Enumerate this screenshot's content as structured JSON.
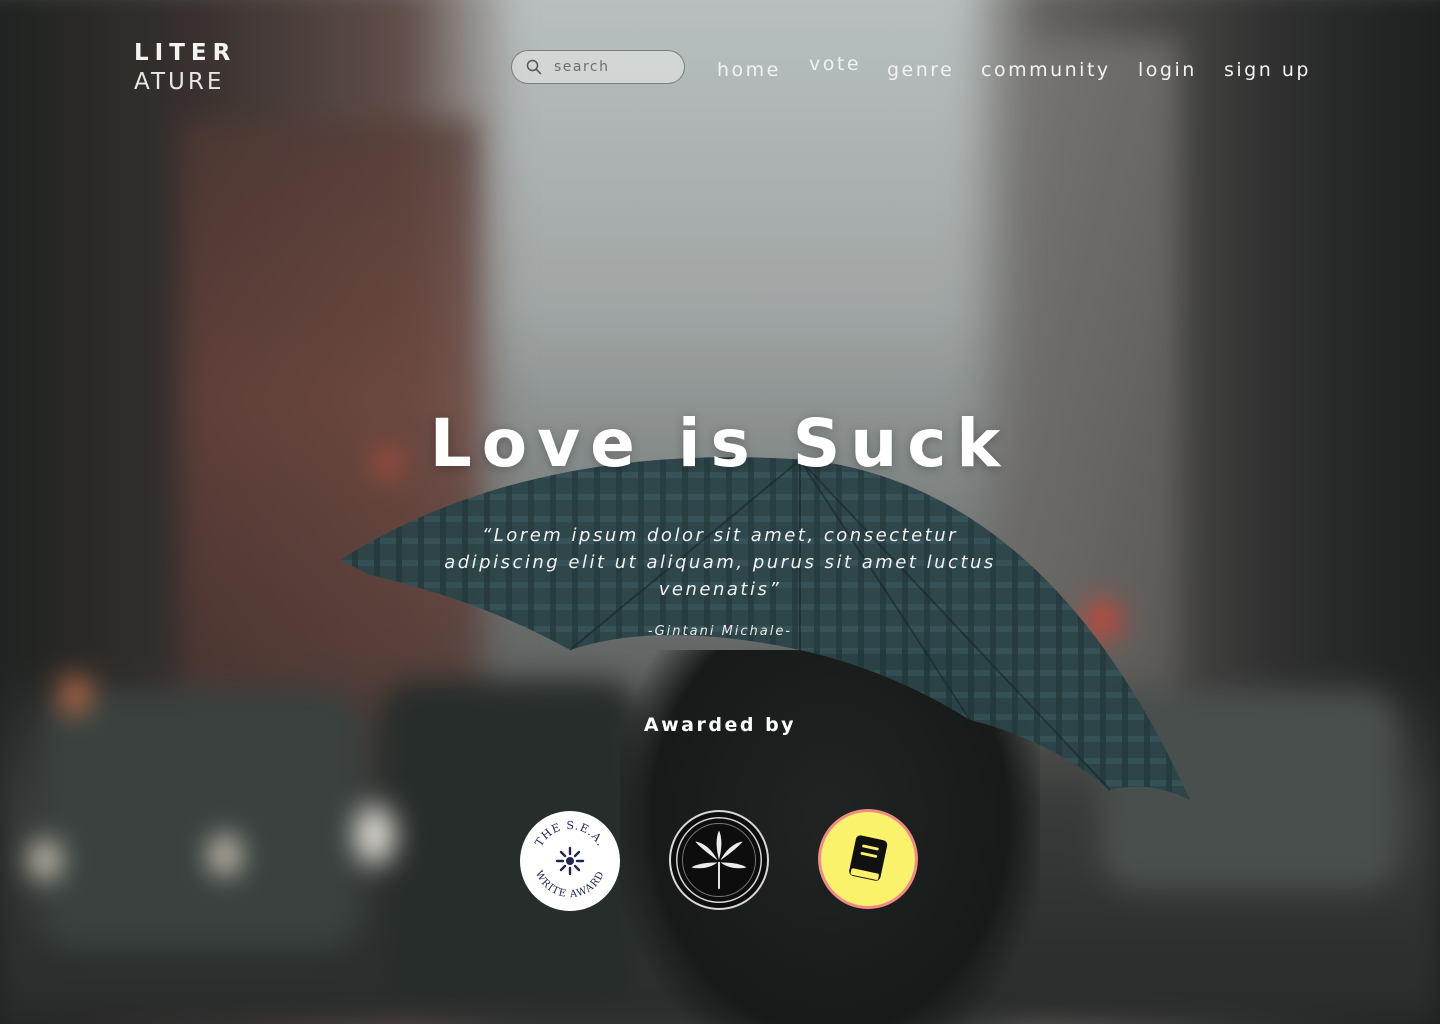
{
  "logo": {
    "line1": "LITER",
    "line2": "ATURE"
  },
  "search": {
    "placeholder": "search",
    "value": "",
    "icon": "search-icon"
  },
  "nav": {
    "home": "home",
    "vote": "vote",
    "genre": "genre",
    "community": "community",
    "login": "login",
    "signup": "sign up"
  },
  "hero": {
    "title": "Love is Suck",
    "quote": "“Lorem ipsum dolor sit amet, consectetur adipiscing elit ut aliquam, purus sit amet luctus venenatis”",
    "author": "-Gintani Michale-"
  },
  "awards": {
    "heading": "Awarded by",
    "items": [
      {
        "name": "sea-write-award",
        "text_top": "THE S.E.A.",
        "text_bottom": "WRITE AWARD",
        "icon": "sun-icon"
      },
      {
        "name": "palm-award",
        "icon": "palm-leaf-icon"
      },
      {
        "name": "book-award",
        "icon": "book-icon"
      }
    ]
  },
  "colors": {
    "text": "#ffffff",
    "book_badge_fill": "#fbf26c",
    "book_badge_ring": "#f08a84",
    "palm_badge_fill": "#0d0d0d"
  }
}
